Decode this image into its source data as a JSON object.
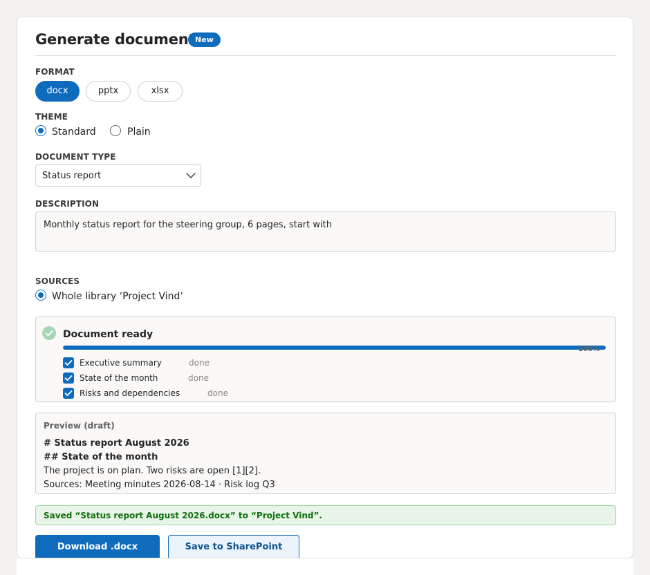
{
  "header": {
    "title": "Generate document",
    "badge": "New"
  },
  "format": {
    "label": "FORMAT",
    "options": [
      "docx",
      "pptx",
      "xlsx"
    ],
    "selected": "docx"
  },
  "theme": {
    "label": "THEME",
    "options": [
      "Standard",
      "Plain"
    ],
    "selected": "Standard"
  },
  "document_type": {
    "label": "DOCUMENT TYPE",
    "value": "Status report"
  },
  "description": {
    "label": "DESCRIPTION",
    "value": "Monthly status report for the steering group, 6 pages, start with"
  },
  "sources": {
    "label": "SOURCES",
    "option": "Whole library ‘Project Vind’"
  },
  "status": {
    "title": "Document ready",
    "progress_percent": 100,
    "progress_label": "100%",
    "steps": [
      {
        "name": "Executive summary",
        "status": "done"
      },
      {
        "name": "State of the month",
        "status": "done"
      },
      {
        "name": "Risks and dependencies",
        "status": "done"
      }
    ]
  },
  "preview": {
    "label": "Preview (draft)",
    "lines": [
      "# Status report August 2026",
      "## State of the month",
      "The project is on plan. Two risks are open [1][2].",
      "Sources: Meeting minutes 2026-08-14 · Risk log Q3"
    ]
  },
  "success_message": "Saved “Status report August 2026.docx” to “Project Vind”.",
  "actions": {
    "download": "Download .docx",
    "save": "Save to SharePoint"
  },
  "colors": {
    "accent": "#0f6cbd",
    "success": "#0e700e",
    "success_bg": "#e9f5e9"
  }
}
